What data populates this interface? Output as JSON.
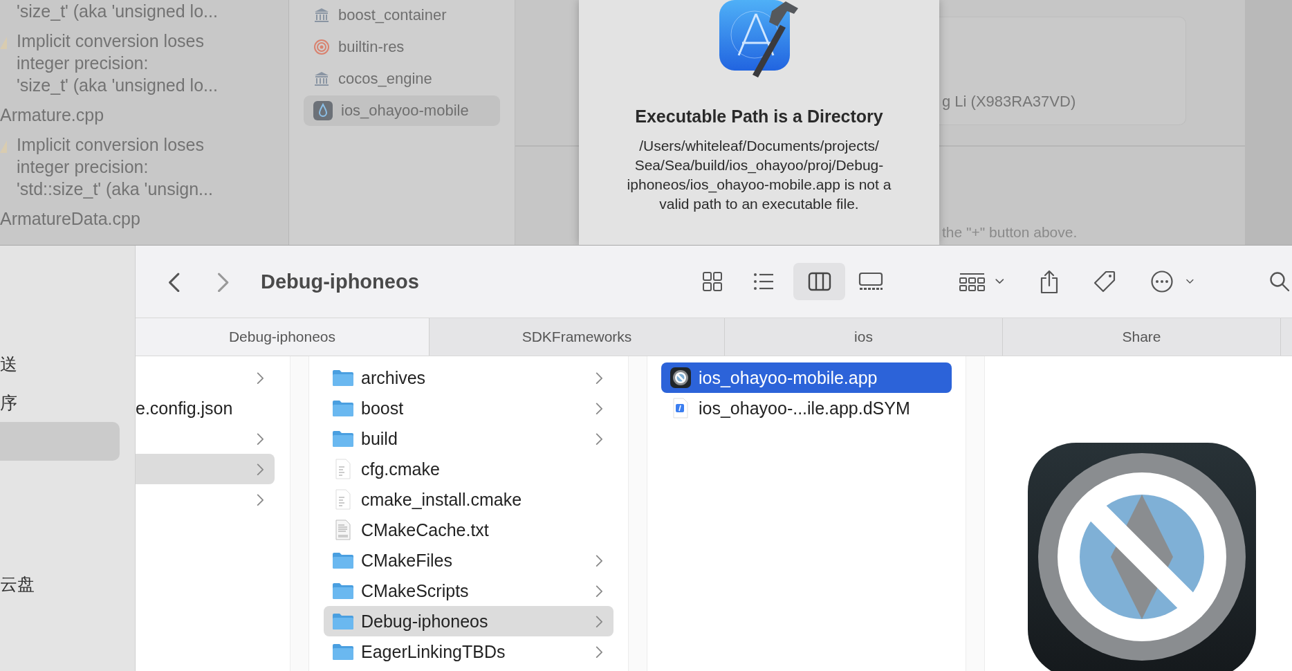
{
  "xcode_background": {
    "issue_navigator": [
      {
        "kind": "continuation",
        "text": "'size_t' (aka 'unsigned lo..."
      },
      {
        "kind": "warning",
        "text": "Implicit conversion loses\ninteger precision:\n'size_t' (aka 'unsigned lo..."
      },
      {
        "kind": "file",
        "text": "Armature.cpp"
      },
      {
        "kind": "warning",
        "text": "Implicit conversion loses\ninteger precision:\n'std::size_t' (aka 'unsign..."
      },
      {
        "kind": "file",
        "text": "ArmatureData.cpp"
      }
    ],
    "targets": [
      {
        "kind": "library",
        "label": "boost_container",
        "selected": false
      },
      {
        "kind": "target",
        "label": "builtin-res",
        "selected": false
      },
      {
        "kind": "library",
        "label": "cocos_engine",
        "selected": false
      },
      {
        "kind": "app",
        "label": "ios_ohayoo-mobile",
        "selected": true
      }
    ],
    "signing_team": "g Li (X983RA37VD)",
    "hint": "the \"+\" button above."
  },
  "alert": {
    "title": "Executable Path is a Directory",
    "message": "/Users/whiteleaf/Documents/projects/\nSea/Sea/build/ios_ohayoo/proj/Debug-\niphoneos/ios_ohayoo-mobile.app is not a\nvalid path to an executable file."
  },
  "finder": {
    "sidebar": [
      {
        "label": "送",
        "selected": false
      },
      {
        "label": "序",
        "selected": false
      },
      {
        "selected": true
      },
      {
        "label": "云盘",
        "selected": false
      }
    ],
    "title": "Debug-iphoneos",
    "view_modes": [
      {
        "kind": "icons",
        "selected": false
      },
      {
        "kind": "list",
        "selected": false
      },
      {
        "kind": "columns",
        "selected": true
      },
      {
        "kind": "gallery",
        "selected": false
      }
    ],
    "path_tabs": [
      {
        "label": "Debug-iphoneos",
        "selected": true
      },
      {
        "label": "SDKFrameworks",
        "selected": false
      },
      {
        "label": "ios",
        "selected": false
      },
      {
        "label": "Share",
        "selected": false
      }
    ],
    "columns": [
      [
        {
          "has_children": true,
          "selected": false
        },
        {
          "label": "e.config.json",
          "has_children": false,
          "selected": false
        },
        {
          "has_children": true,
          "selected": false
        },
        {
          "has_children": true,
          "selected": true
        },
        {
          "has_children": true,
          "selected": false
        }
      ],
      [
        {
          "kind": "folder",
          "label": "archives",
          "has_children": true,
          "selected": false
        },
        {
          "kind": "folder",
          "label": "boost",
          "has_children": true,
          "selected": false
        },
        {
          "kind": "folder",
          "label": "build",
          "has_children": true,
          "selected": false
        },
        {
          "kind": "document",
          "label": "cfg.cmake",
          "has_children": false,
          "selected": false
        },
        {
          "kind": "document",
          "label": "cmake_install.cmake",
          "has_children": false,
          "selected": false
        },
        {
          "kind": "text",
          "label": "CMakeCache.txt",
          "has_children": false,
          "selected": false
        },
        {
          "kind": "folder",
          "label": "CMakeFiles",
          "has_children": true,
          "selected": false
        },
        {
          "kind": "folder",
          "label": "CMakeScripts",
          "has_children": true,
          "selected": false
        },
        {
          "kind": "folder",
          "label": "Debug-iphoneos",
          "has_children": true,
          "selected": true
        },
        {
          "kind": "folder",
          "label": "EagerLinkingTBDs",
          "has_children": true,
          "selected": false
        }
      ],
      [
        {
          "kind": "app",
          "label": "ios_ohayoo-mobile.app",
          "has_children": false,
          "selected": true
        },
        {
          "kind": "dsym",
          "label": "ios_ohayoo-...ile.app.dSYM",
          "has_children": false,
          "selected": false
        }
      ]
    ]
  }
}
